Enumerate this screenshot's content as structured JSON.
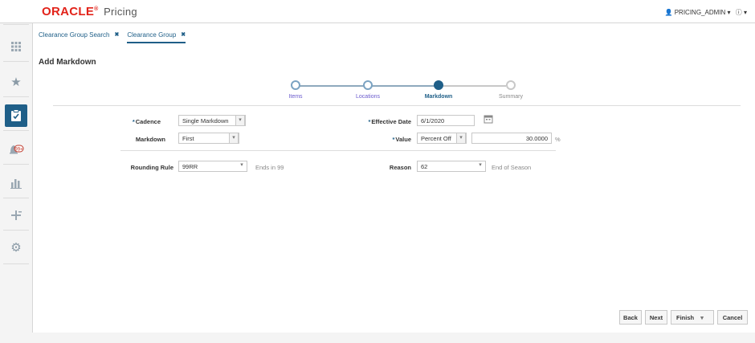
{
  "app": {
    "brand": "ORACLE",
    "product": "Pricing",
    "user": "PRICING_ADMIN"
  },
  "tabs": [
    {
      "label": "Clearance Group Search",
      "close": "✖"
    },
    {
      "label": "Clearance Group",
      "close": "✖"
    }
  ],
  "page": {
    "title": "Add Markdown"
  },
  "train": {
    "steps": [
      {
        "label": "Items",
        "state": "done"
      },
      {
        "label": "Locations",
        "state": "done"
      },
      {
        "label": "Markdown",
        "state": "current"
      },
      {
        "label": "Summary",
        "state": "future"
      }
    ]
  },
  "form": {
    "cadence": {
      "label": "Cadence",
      "value": "Single Markdown"
    },
    "markdown": {
      "label": "Markdown",
      "value": "First"
    },
    "rounding": {
      "label": "Rounding Rule",
      "value": "99RR",
      "hint": "Ends in 99"
    },
    "effective_date": {
      "label": "Effective Date",
      "value": "6/1/2020"
    },
    "value": {
      "label": "Value",
      "type": "Percent Off",
      "amount": "30.0000",
      "unit": "%"
    },
    "reason": {
      "label": "Reason",
      "value": "62",
      "hint": "End of Season"
    }
  },
  "buttons": {
    "back": "Back",
    "next": "Next",
    "finish": "Finish",
    "cancel": "Cancel"
  },
  "icons": {
    "hamburger": "☰",
    "apps": "⋮⋮⋮",
    "star": "★",
    "tasks": "✔",
    "notifications": "🔔",
    "reports": "▮▮▮",
    "add": "+",
    "settings": "⚙",
    "calendar": "▦",
    "dropdown": "▾"
  }
}
